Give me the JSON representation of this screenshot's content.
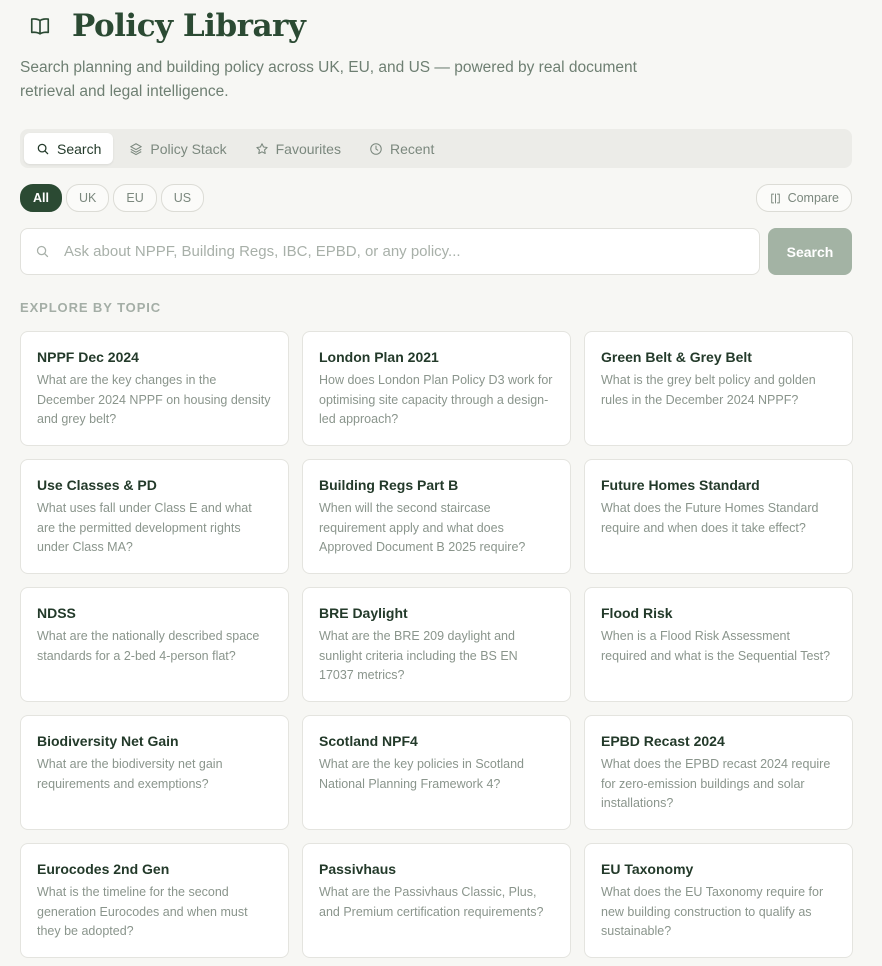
{
  "header": {
    "title": "Policy Library",
    "icon": "book-icon"
  },
  "subtitle": "Search planning and building policy across UK, EU, and US — powered by real document retrieval and legal intelligence.",
  "tabs": [
    {
      "label": "Search",
      "icon": "search-icon",
      "active": true
    },
    {
      "label": "Policy Stack",
      "icon": "layers-icon"
    },
    {
      "label": "Favourites",
      "icon": "star-icon"
    },
    {
      "label": "Recent",
      "icon": "clock-icon"
    }
  ],
  "filters": [
    {
      "label": "All",
      "active": true
    },
    {
      "label": "UK"
    },
    {
      "label": "EU"
    },
    {
      "label": "US"
    }
  ],
  "compare_label": "Compare",
  "search": {
    "placeholder": "Ask about NPPF, Building Regs, IBC, EPBD, or any policy...",
    "button_label": "Search"
  },
  "section_label": "EXPLORE BY TOPIC",
  "topics": [
    {
      "title": "NPPF Dec 2024",
      "question": "What are the key changes in the December 2024 NPPF on housing density and grey belt?"
    },
    {
      "title": "London Plan 2021",
      "question": "How does London Plan Policy D3 work for optimising site capacity through a design-led approach?"
    },
    {
      "title": "Green Belt & Grey Belt",
      "question": "What is the grey belt policy and golden rules in the December 2024 NPPF?"
    },
    {
      "title": "Use Classes & PD",
      "question": "What uses fall under Class E and what are the permitted development rights under Class MA?"
    },
    {
      "title": "Building Regs Part B",
      "question": "When will the second staircase requirement apply and what does Approved Document B 2025 require?"
    },
    {
      "title": "Future Homes Standard",
      "question": "What does the Future Homes Standard require and when does it take effect?"
    },
    {
      "title": "NDSS",
      "question": "What are the nationally described space standards for a 2-bed 4-person flat?"
    },
    {
      "title": "BRE Daylight",
      "question": "What are the BRE 209 daylight and sunlight criteria including the BS EN 17037 metrics?"
    },
    {
      "title": "Flood Risk",
      "question": "When is a Flood Risk Assessment required and what is the Sequential Test?"
    },
    {
      "title": "Biodiversity Net Gain",
      "question": "What are the biodiversity net gain requirements and exemptions?"
    },
    {
      "title": "Scotland NPF4",
      "question": "What are the key policies in Scotland National Planning Framework 4?"
    },
    {
      "title": "EPBD Recast 2024",
      "question": "What does the EPBD recast 2024 require for zero-emission buildings and solar installations?"
    },
    {
      "title": "Eurocodes 2nd Gen",
      "question": "What is the timeline for the second generation Eurocodes and when must they be adopted?"
    },
    {
      "title": "Passivhaus",
      "question": "What are the Passivhaus Classic, Plus, and Premium certification requirements?"
    },
    {
      "title": "EU Taxonomy",
      "question": "What does the EU Taxonomy require for new building construction to qualify as sustainable?"
    }
  ]
}
